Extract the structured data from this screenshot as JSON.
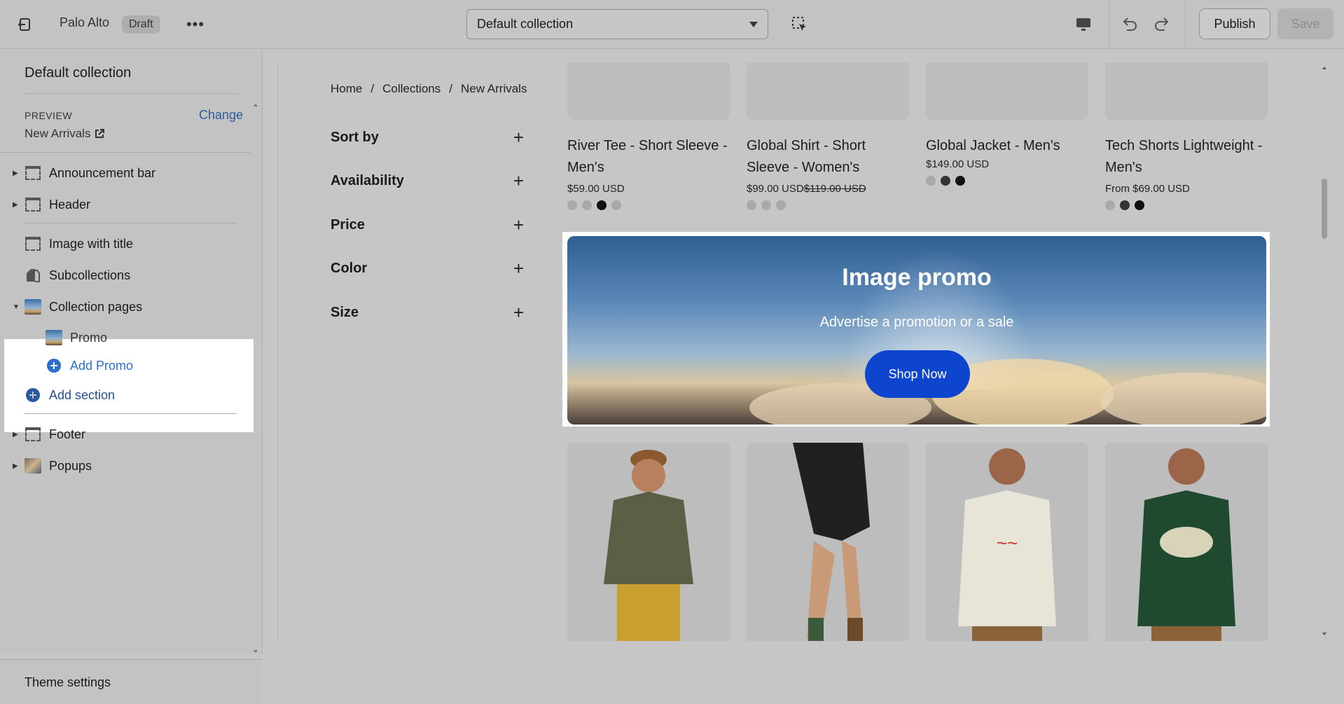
{
  "topbar": {
    "store_name": "Palo Alto",
    "status_badge": "Draft",
    "template_select": "Default collection",
    "publish_label": "Publish",
    "save_label": "Save"
  },
  "sidebar": {
    "title": "Default collection",
    "preview_label": "PREVIEW",
    "preview_change": "Change",
    "preview_value": "New Arrivals",
    "items": [
      {
        "label": "Announcement bar",
        "icon": "section-icon"
      },
      {
        "label": "Header",
        "icon": "section-icon"
      },
      {
        "label": "Image with title",
        "icon": "section-icon"
      },
      {
        "label": "Subcollections",
        "icon": "tags-icon"
      },
      {
        "label": "Collection pages",
        "icon": "image-thumbnail-icon"
      },
      {
        "label": "Promo",
        "icon": "image-thumbnail-icon"
      },
      {
        "label": "Add Promo",
        "icon": "add-circle-icon"
      },
      {
        "label": "Add section",
        "icon": "add-circle-icon"
      },
      {
        "label": "Footer",
        "icon": "section-icon"
      },
      {
        "label": "Popups",
        "icon": "image-thumbnail-icon"
      }
    ],
    "theme_settings": "Theme settings"
  },
  "preview": {
    "breadcrumbs": [
      "Home",
      "/",
      "Collections",
      "/",
      "New Arrivals"
    ],
    "filters": [
      "Sort by",
      "Availability",
      "Price",
      "Color",
      "Size"
    ],
    "products": [
      {
        "name": "River Tee - Short Sleeve - Men's",
        "price": "$59.00 USD",
        "compare": "",
        "swatches": [
          "#a9a9a9",
          "#a9a9a9",
          "#111111",
          "#a9a9a9"
        ]
      },
      {
        "name": "Global Shirt - Short Sleeve - Women's",
        "price": "$99.00 USD",
        "compare": "$119.00 USD",
        "swatches": [
          "#a9a9a9",
          "#a9a9a9",
          "#a9a9a9"
        ]
      },
      {
        "name": "Global Jacket - Men's",
        "price": "$149.00 USD",
        "compare": "",
        "swatches": [
          "#a9a9a9",
          "#333333",
          "#111111"
        ]
      },
      {
        "name": "Tech Shorts Lightweight - Men's",
        "price": "From $69.00 USD",
        "compare": "",
        "swatches": [
          "#a9a9a9",
          "#333333",
          "#111111"
        ]
      }
    ],
    "promo": {
      "title": "Image promo",
      "subtitle": "Advertise a promotion or a sale",
      "button": "Shop Now"
    }
  }
}
